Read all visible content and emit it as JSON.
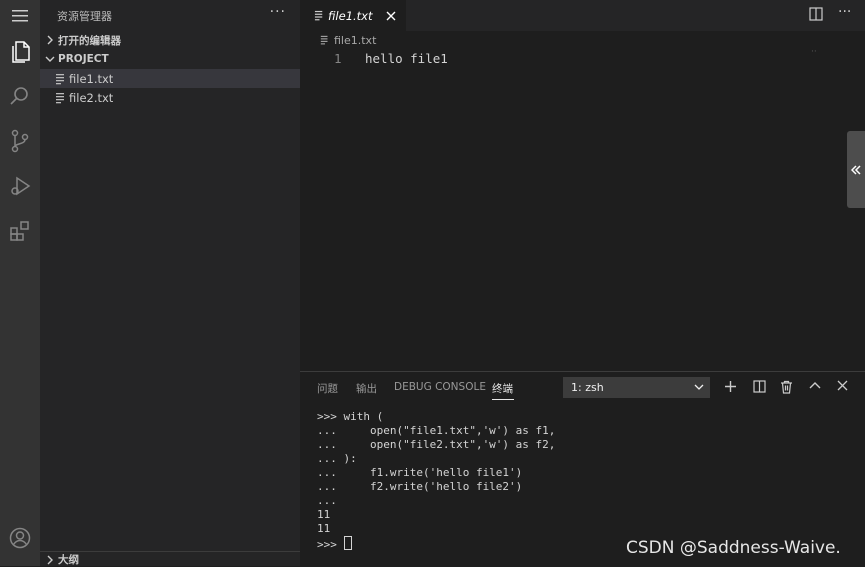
{
  "sidebar": {
    "title": "资源管理器",
    "more": "···",
    "open_editors": "打开的编辑器",
    "project": "PROJECT",
    "files": [
      "file1.txt",
      "file2.txt"
    ],
    "outline": "大纲"
  },
  "editor": {
    "tab_label": "file1.txt",
    "breadcrumb": "file1.txt",
    "line_number": "1",
    "line_text": "hello file1",
    "minimap_mark": "··"
  },
  "panel": {
    "tabs": [
      "问题",
      "输出",
      "DEBUG CONSOLE",
      "终端"
    ],
    "terminal_select": "1: zsh",
    "terminal_lines": [
      ">>> with (",
      "...     open(\"file1.txt\",'w') as f1,",
      "...     open(\"file2.txt\",'w') as f2,",
      "... ):",
      "...     f1.write('hello file1')",
      "...     f2.write('hello file2')",
      "...",
      "11",
      "11"
    ],
    "prompt": ">>> "
  },
  "watermark": "CSDN @Saddness-Waive."
}
